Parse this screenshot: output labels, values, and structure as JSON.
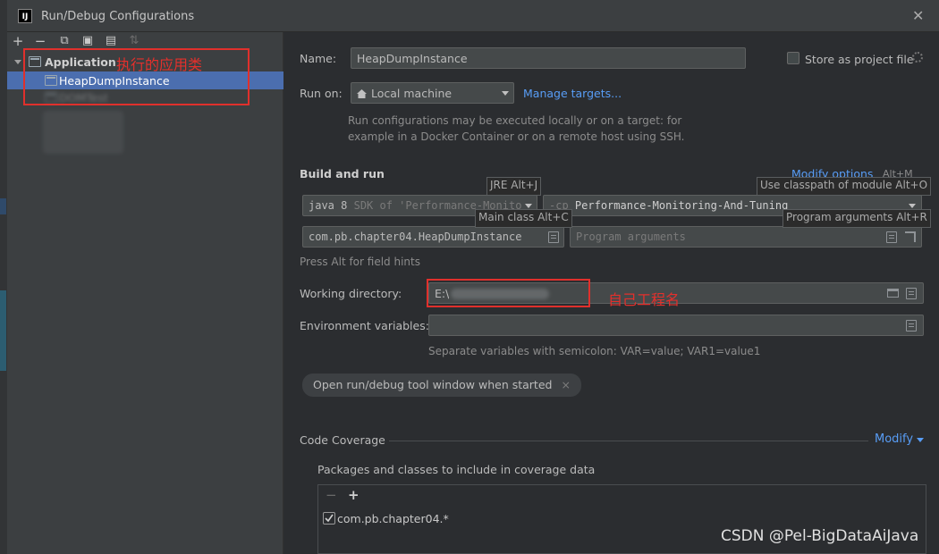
{
  "window": {
    "title": "Run/Debug Configurations",
    "logo_text": "IJ",
    "close_glyph": "✕"
  },
  "toolbar": {
    "add": "+",
    "remove": "−",
    "copy": "⧉",
    "save": "▣",
    "folder": "▤",
    "sort": "⇅"
  },
  "tree": {
    "group_label": "Application",
    "selected_item": "HeapDumpInstance",
    "blurred_item": "DOMTest"
  },
  "annotations": {
    "app_class": "执行的应用类",
    "own_project": "自己工程名"
  },
  "form": {
    "name_label": "Name:",
    "name_value": "HeapDumpInstance",
    "store_label": "Store as project file",
    "run_on_label": "Run on:",
    "run_on_value": "Local machine",
    "manage_targets": "Manage targets...",
    "run_on_hint_1": "Run configurations may be executed locally or on a target: for",
    "run_on_hint_2": "example in a Docker Container or on a remote host using SSH.",
    "build_run_title": "Build and run",
    "modify_options": "Modify options",
    "modify_options_shortcut": "Alt+M",
    "jre_tooltip": "JRE Alt+J",
    "classpath_tooltip": "Use classpath of module Alt+O",
    "main_class_tooltip": "Main class Alt+C",
    "program_args_tooltip": "Program arguments Alt+R",
    "jre_value": "java 8",
    "jre_sdk": "SDK of 'Performance-Monito",
    "cp_prefix": "-cp",
    "cp_value": "Performance-Monitoring-And-Tuning",
    "main_class_value": "com.pb.chapter04.HeapDumpInstance",
    "program_args_placeholder": "Program arguments",
    "field_hints": "Press Alt for field hints",
    "workdir_label": "Working directory:",
    "workdir_value": "E:\\",
    "env_label": "Environment variables:",
    "env_hint": "Separate variables with semicolon: VAR=value; VAR1=value1",
    "chip_label": "Open run/debug tool window when started",
    "chip_close": "×"
  },
  "coverage": {
    "title": "Code Coverage",
    "modify": "Modify",
    "packages_label": "Packages and classes to include in coverage data",
    "remove_glyph": "−",
    "add_glyph": "+",
    "entry": "com.pb.chapter04.*",
    "entry_checked": true
  },
  "watermark": "CSDN @Pel-BigDataAiJava",
  "colors": {
    "selection": "#4b6eaf",
    "link": "#589df6",
    "annotation_red": "#e0302c"
  }
}
